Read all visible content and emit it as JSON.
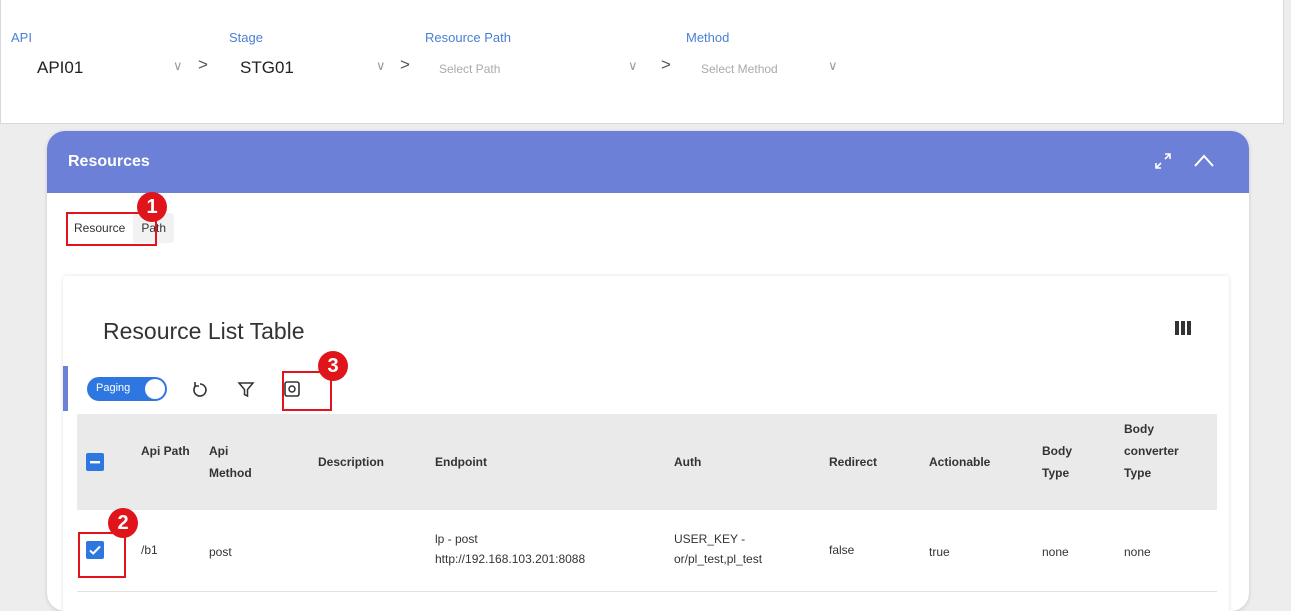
{
  "selectors": [
    {
      "label": "API",
      "value": "API01",
      "placeholder": false
    },
    {
      "label": "Stage",
      "value": "STG01",
      "placeholder": false
    },
    {
      "label": "Resource Path",
      "value": "Select Path",
      "placeholder": true
    },
    {
      "label": "Method",
      "value": "Select Method",
      "placeholder": true
    }
  ],
  "separator": ">",
  "panel": {
    "title": "Resources",
    "tabs": [
      "Resource",
      "Path"
    ]
  },
  "card": {
    "title": "Resource List Table",
    "toolbar": {
      "paging_label": "Paging",
      "paging_on": true
    }
  },
  "table": {
    "columns": [
      "Api Path",
      "Api Method",
      "Description",
      "Endpoint",
      "Auth",
      "Redirect",
      "Actionable",
      "Body Type",
      "Body converter Type"
    ],
    "rows": [
      {
        "checked": true,
        "api_path": "/b1",
        "api_method": "post",
        "description": "",
        "endpoint_line1": "lp - post",
        "endpoint_line2": "http://192.168.103.201:8088",
        "auth_line1": "USER_KEY -",
        "auth_line2": "or/pl_test,pl_test",
        "redirect": "false",
        "actionable": "true",
        "body_type": "none",
        "body_converter_type": "none"
      }
    ]
  },
  "annotations": [
    "1",
    "2",
    "3"
  ],
  "colors": {
    "header": "#6b80d6",
    "accent_blue": "#2f77e0",
    "annotation_red": "#e0151b"
  }
}
